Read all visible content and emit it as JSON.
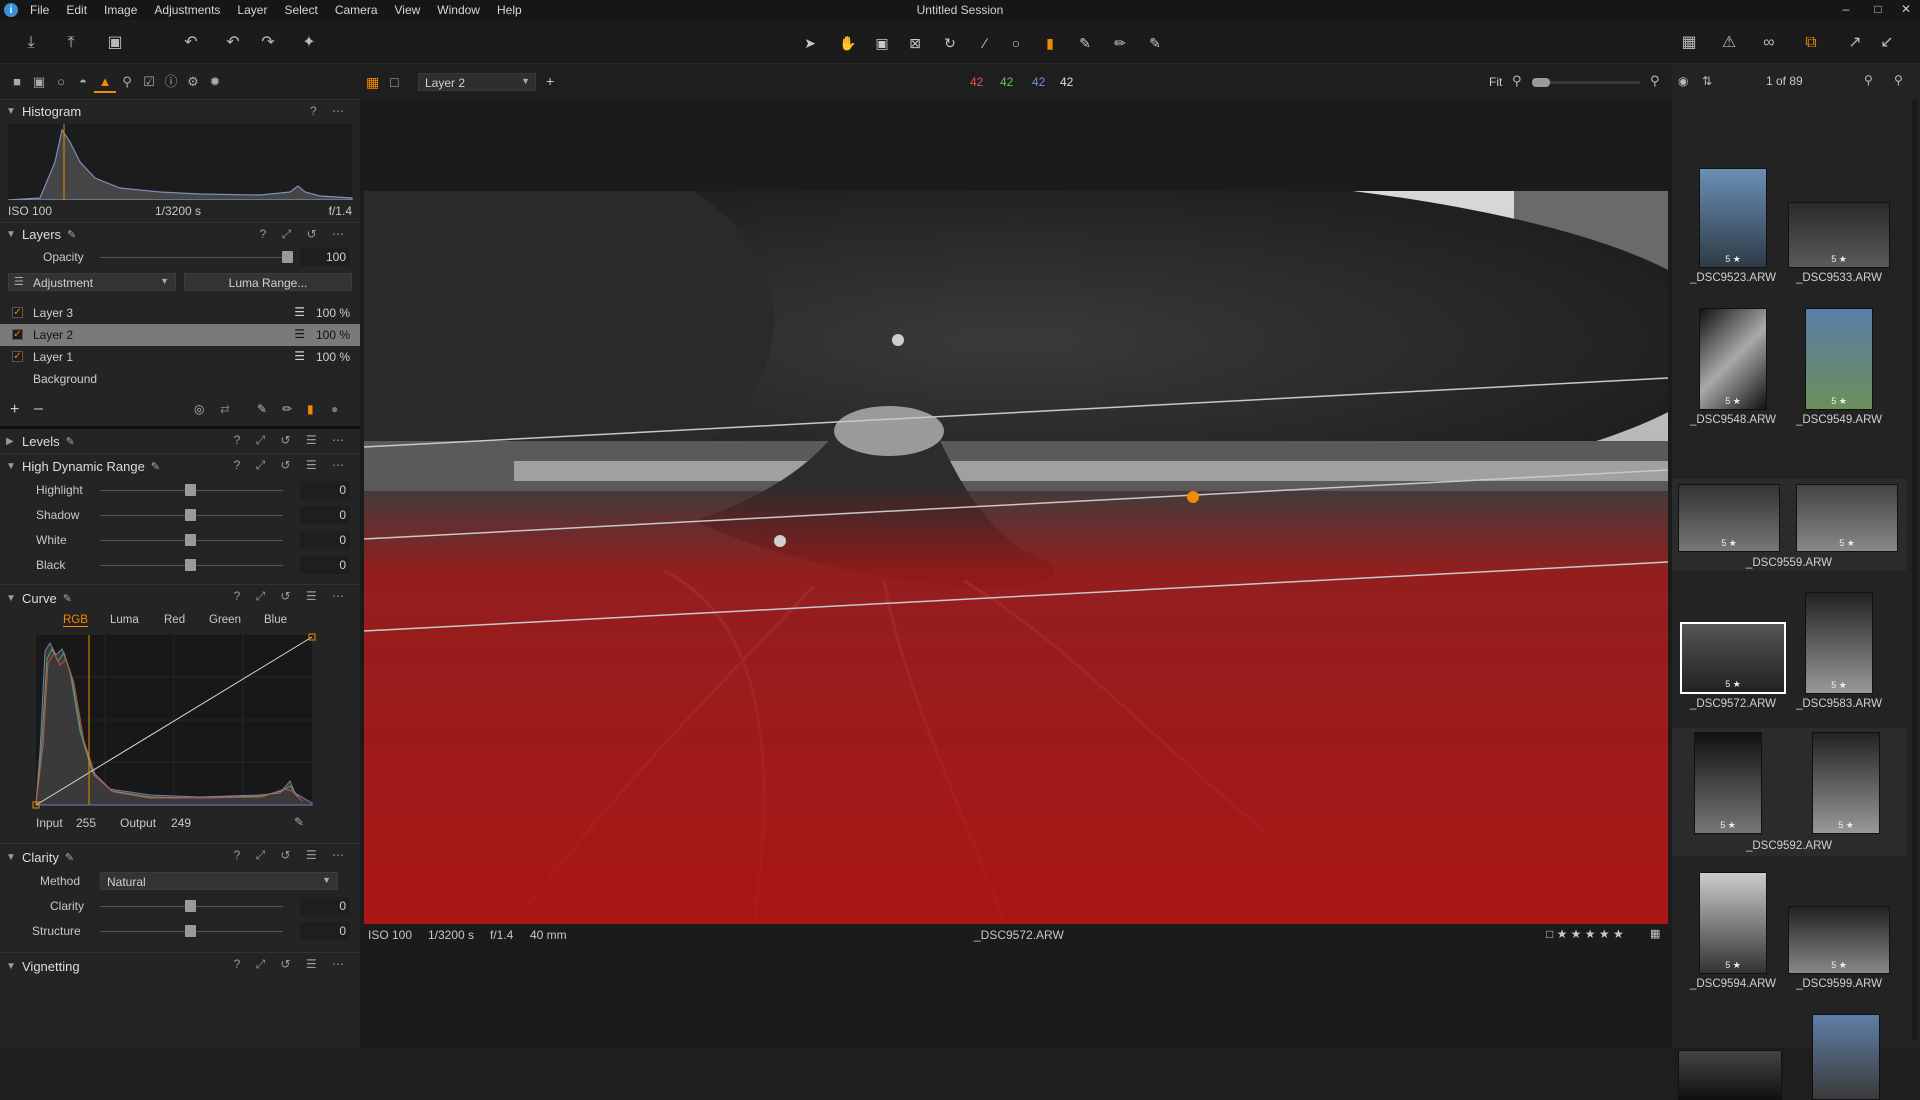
{
  "window": {
    "title": "Untitled Session"
  },
  "menu": [
    "File",
    "Edit",
    "Image",
    "Adjustments",
    "Layer",
    "Select",
    "Camera",
    "View",
    "Window",
    "Help"
  ],
  "viewer_bar": {
    "layer_select": "Layer 2",
    "rgb": {
      "r": "42",
      "g": "42",
      "b": "42",
      "l": "42"
    },
    "zoom_label": "Fit"
  },
  "browser": {
    "count": "1 of 89"
  },
  "histogram": {
    "title": "Histogram",
    "iso": "ISO 100",
    "shutter": "1/3200 s",
    "aperture": "f/1.4"
  },
  "layers": {
    "title": "Layers",
    "opacity_label": "Opacity",
    "opacity_value": "100",
    "adjust_select": "Adjustment",
    "luma_button": "Luma Range...",
    "items": [
      {
        "name": "Layer 3",
        "pct": "100 %"
      },
      {
        "name": "Layer 2",
        "pct": "100 %"
      },
      {
        "name": "Layer 1",
        "pct": "100 %"
      },
      {
        "name": "Background",
        "pct": ""
      }
    ]
  },
  "levels": {
    "title": "Levels"
  },
  "hdr": {
    "title": "High Dynamic Range",
    "sliders": [
      {
        "label": "Highlight",
        "value": "0"
      },
      {
        "label": "Shadow",
        "value": "0"
      },
      {
        "label": "White",
        "value": "0"
      },
      {
        "label": "Black",
        "value": "0"
      }
    ]
  },
  "curve": {
    "title": "Curve",
    "tabs": [
      "RGB",
      "Luma",
      "Red",
      "Green",
      "Blue"
    ],
    "input_label": "Input",
    "input_value": "255",
    "output_label": "Output",
    "output_value": "249"
  },
  "clarity": {
    "title": "Clarity",
    "method_label": "Method",
    "method_value": "Natural",
    "sliders": [
      {
        "label": "Clarity",
        "value": "0"
      },
      {
        "label": "Structure",
        "value": "0"
      }
    ]
  },
  "vignetting": {
    "title": "Vignetting"
  },
  "viewer_info": {
    "iso": "ISO 100",
    "shutter": "1/3200 s",
    "aperture": "f/1.4",
    "focal": "40 mm",
    "filename": "_DSC9572.ARW"
  },
  "thumbnails": [
    {
      "name": "_DSC9523.ARW",
      "rating": "5 ★"
    },
    {
      "name": "_DSC9533.ARW",
      "rating": "5 ★"
    },
    {
      "name": "_DSC9548.ARW",
      "rating": "5 ★"
    },
    {
      "name": "_DSC9549.ARW",
      "rating": "5 ★"
    },
    {
      "name": "_DSC9559.ARW",
      "rating": "5 ★"
    },
    {
      "name": "_DSC9572.ARW",
      "rating": "5 ★"
    },
    {
      "name": "_DSC9583.ARW",
      "rating": "5 ★"
    },
    {
      "name": "_DSC9592.ARW",
      "rating": "5 ★"
    },
    {
      "name": "_DSC9594.ARW",
      "rating": "5 ★"
    },
    {
      "name": "_DSC9599.ARW",
      "rating": "5 ★"
    }
  ],
  "colors": {
    "accent": "#f08a00",
    "mask_red": "#b01414"
  }
}
